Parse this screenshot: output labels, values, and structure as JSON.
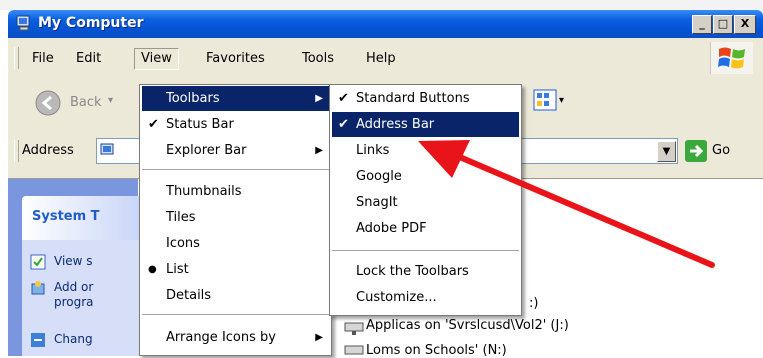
{
  "window": {
    "title": "My Computer"
  },
  "caption_buttons": {
    "minimize": "_",
    "maximize": "□",
    "close": "X"
  },
  "menubar": {
    "items": [
      {
        "label": "File"
      },
      {
        "label": "Edit"
      },
      {
        "label": "View"
      },
      {
        "label": "Favorites"
      },
      {
        "label": "Tools"
      },
      {
        "label": "Help"
      }
    ]
  },
  "toolbar": {
    "back_label": "Back"
  },
  "addressbar": {
    "label": "Address",
    "go_label": "Go"
  },
  "taskpanel": {
    "header": "System T",
    "tasks": [
      {
        "line1": "View s",
        "line2": ""
      },
      {
        "line1": "Add or",
        "line2": "progra"
      },
      {
        "line1": "Chang",
        "line2": ""
      }
    ]
  },
  "content": {
    "drives": [
      {
        "label": "Applicas on 'Svrslcusd\\Vol2' (J:)"
      },
      {
        "label": "Loms on Schools' (N:)"
      }
    ],
    "partial_text": ":)"
  },
  "view_menu": {
    "items": [
      {
        "label": "Toolbars",
        "has_submenu": true,
        "checked": false,
        "selected": true
      },
      {
        "label": "Status Bar",
        "checked": true
      },
      {
        "label": "Explorer Bar",
        "has_submenu": true
      },
      {
        "label": "Thumbnails"
      },
      {
        "label": "Tiles"
      },
      {
        "label": "Icons"
      },
      {
        "label": "List",
        "radio": true
      },
      {
        "label": "Details"
      },
      {
        "label": "Arrange Icons by",
        "has_submenu": true
      }
    ]
  },
  "toolbars_submenu": {
    "items": [
      {
        "label": "Standard Buttons",
        "checked": true
      },
      {
        "label": "Address Bar",
        "checked": true,
        "selected": true
      },
      {
        "label": "Links"
      },
      {
        "label": "Google"
      },
      {
        "label": "SnagIt"
      },
      {
        "label": "Adobe PDF"
      },
      {
        "label": "Lock the Toolbars"
      },
      {
        "label": "Customize..."
      }
    ]
  },
  "glyphs": {
    "check": "✔",
    "radio": "●",
    "submenu": "▶"
  },
  "colors": {
    "titlebar": "#0553d3",
    "menu_highlight": "#0a246a",
    "arrow": "#e8141a",
    "chrome": "#ece9d8"
  }
}
